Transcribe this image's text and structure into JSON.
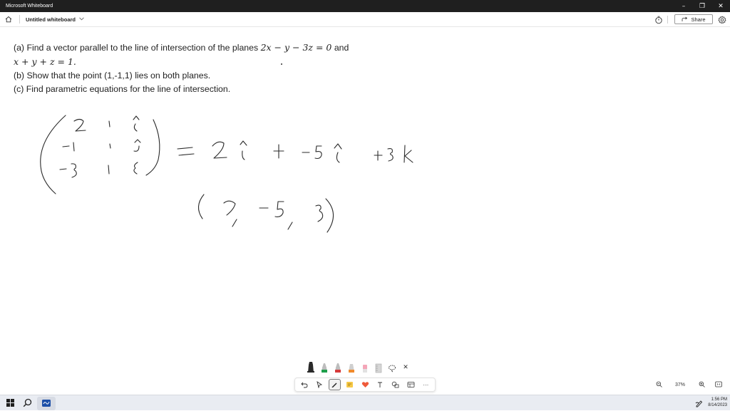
{
  "window": {
    "title": "Microsoft Whiteboard",
    "controls": {
      "minimize": "–",
      "restore": "❐",
      "close": "✕"
    }
  },
  "toolbar": {
    "board_title": "Untitled whiteboard",
    "share_label": "Share"
  },
  "problem": {
    "part_a_text": "(a) Find a vector parallel to the line of intersection of the planes",
    "part_a_eq1": "2x − y − 3z = 0",
    "part_a_and": "and",
    "part_a_eq2": "x + y + z = 1.",
    "part_b": "(b) Show that the point (1,-1,1) lies on both planes.",
    "part_c": "(c) Find parametric equations for the line of intersection."
  },
  "ink_tray": {
    "pens": [
      {
        "name": "black-pen",
        "color": "#222222"
      },
      {
        "name": "green-pen",
        "color": "#1e9e4a"
      },
      {
        "name": "red-pen",
        "color": "#d63b3b"
      },
      {
        "name": "orange-highlighter",
        "color": "#f08a2c"
      },
      {
        "name": "eraser",
        "color": "#f4a6b8"
      },
      {
        "name": "ruler",
        "color": "#b8b8b8"
      }
    ],
    "close_label": "✕"
  },
  "bottom_toolbar": {
    "more_label": "···"
  },
  "zoom": {
    "level": "37%"
  },
  "taskbar": {
    "time": "1:56 PM",
    "date": "8/14/2023"
  }
}
